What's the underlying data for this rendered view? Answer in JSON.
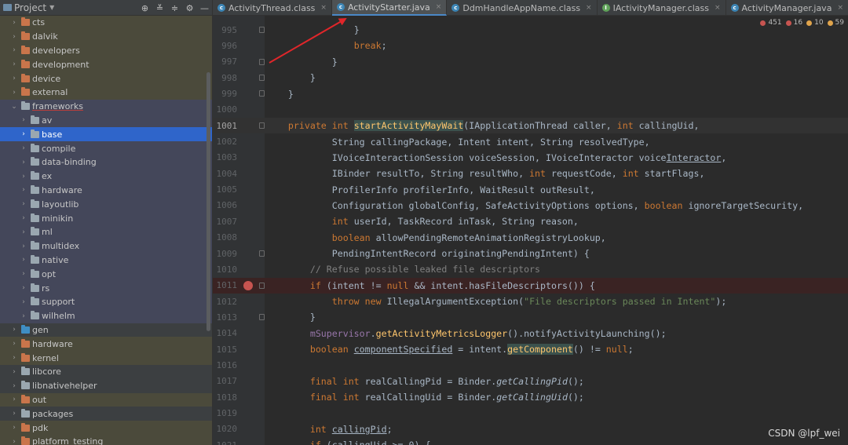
{
  "panel": {
    "title": "Project",
    "header_icons": [
      "⊕",
      "≚",
      "≑",
      "⚙",
      "—"
    ]
  },
  "tree": [
    {
      "label": "cts",
      "depth": 0,
      "chev": "›",
      "color": "orange",
      "tint": "tint"
    },
    {
      "label": "dalvik",
      "depth": 0,
      "chev": "›",
      "color": "orange",
      "tint": "tint"
    },
    {
      "label": "developers",
      "depth": 0,
      "chev": "›",
      "color": "orange",
      "tint": "tint"
    },
    {
      "label": "development",
      "depth": 0,
      "chev": "›",
      "color": "orange",
      "tint": "tint"
    },
    {
      "label": "device",
      "depth": 0,
      "chev": "›",
      "color": "orange",
      "tint": "tint"
    },
    {
      "label": "external",
      "depth": 0,
      "chev": "›",
      "color": "orange",
      "tint": "tint"
    },
    {
      "label": "frameworks",
      "depth": 0,
      "chev": "⌄",
      "color": "grey",
      "tint": "tint-blue",
      "underline": true
    },
    {
      "label": "av",
      "depth": 1,
      "chev": "›",
      "color": "grey",
      "tint": "tint-blue"
    },
    {
      "label": "base",
      "depth": 1,
      "chev": "›",
      "color": "grey",
      "tint": "selected"
    },
    {
      "label": "compile",
      "depth": 1,
      "chev": "›",
      "color": "grey",
      "tint": "tint-blue"
    },
    {
      "label": "data-binding",
      "depth": 1,
      "chev": "›",
      "color": "grey",
      "tint": "tint-blue"
    },
    {
      "label": "ex",
      "depth": 1,
      "chev": "›",
      "color": "grey",
      "tint": "tint-blue"
    },
    {
      "label": "hardware",
      "depth": 1,
      "chev": "›",
      "color": "grey",
      "tint": "tint-blue"
    },
    {
      "label": "layoutlib",
      "depth": 1,
      "chev": "›",
      "color": "grey",
      "tint": "tint-blue"
    },
    {
      "label": "minikin",
      "depth": 1,
      "chev": "›",
      "color": "grey",
      "tint": "tint-blue"
    },
    {
      "label": "ml",
      "depth": 1,
      "chev": "›",
      "color": "grey",
      "tint": "tint-blue"
    },
    {
      "label": "multidex",
      "depth": 1,
      "chev": "›",
      "color": "grey",
      "tint": "tint-blue"
    },
    {
      "label": "native",
      "depth": 1,
      "chev": "›",
      "color": "grey",
      "tint": "tint-blue"
    },
    {
      "label": "opt",
      "depth": 1,
      "chev": "›",
      "color": "grey",
      "tint": "tint-blue"
    },
    {
      "label": "rs",
      "depth": 1,
      "chev": "›",
      "color": "grey",
      "tint": "tint-blue"
    },
    {
      "label": "support",
      "depth": 1,
      "chev": "›",
      "color": "grey",
      "tint": "tint-blue"
    },
    {
      "label": "wilhelm",
      "depth": 1,
      "chev": "›",
      "color": "grey",
      "tint": "tint-blue"
    },
    {
      "label": "gen",
      "depth": 0,
      "chev": "›",
      "color": "blue",
      "tint": ""
    },
    {
      "label": "hardware",
      "depth": 0,
      "chev": "›",
      "color": "orange",
      "tint": "tint"
    },
    {
      "label": "kernel",
      "depth": 0,
      "chev": "›",
      "color": "orange",
      "tint": "tint"
    },
    {
      "label": "libcore",
      "depth": 0,
      "chev": "›",
      "color": "grey",
      "tint": ""
    },
    {
      "label": "libnativehelper",
      "depth": 0,
      "chev": "›",
      "color": "grey",
      "tint": ""
    },
    {
      "label": "out",
      "depth": 0,
      "chev": "›",
      "color": "orange",
      "tint": "tint"
    },
    {
      "label": "packages",
      "depth": 0,
      "chev": "›",
      "color": "grey",
      "tint": ""
    },
    {
      "label": "pdk",
      "depth": 0,
      "chev": "›",
      "color": "orange",
      "tint": "tint"
    },
    {
      "label": "platform_testing",
      "depth": 0,
      "chev": "›",
      "color": "orange",
      "tint": "tint"
    }
  ],
  "tabs": [
    {
      "label": "ActivityThread.class",
      "icon": "c",
      "kind": "class",
      "active": false
    },
    {
      "label": "ActivityStarter.java",
      "icon": "c",
      "kind": "class",
      "active": true
    },
    {
      "label": "DdmHandleAppName.class",
      "icon": "c",
      "kind": "class",
      "active": false
    },
    {
      "label": "IActivityManager.class",
      "icon": "I",
      "kind": "iface",
      "active": false
    },
    {
      "label": "ActivityManager.java",
      "icon": "c",
      "kind": "class",
      "active": false
    }
  ],
  "tab_close": "×",
  "indicators": [
    {
      "count": "451",
      "color": "#c75450"
    },
    {
      "count": "16",
      "color": "#c75450"
    },
    {
      "count": "10",
      "color": "#e0a44c"
    },
    {
      "count": "59",
      "color": "#e0a44c"
    }
  ],
  "code_lines": [
    {
      "n": "995",
      "fold": true,
      "tokens": [
        [
          "",
          "                "
        ],
        [
          "",
          "}"
        ]
      ]
    },
    {
      "n": "996",
      "tokens": [
        [
          "",
          "                "
        ],
        [
          "kw",
          "break"
        ],
        [
          "",
          ";"
        ]
      ]
    },
    {
      "n": "997",
      "fold": true,
      "tokens": [
        [
          "",
          "            "
        ],
        [
          "",
          "}"
        ]
      ]
    },
    {
      "n": "998",
      "fold": true,
      "tokens": [
        [
          "",
          "        "
        ],
        [
          "",
          "}"
        ]
      ]
    },
    {
      "n": "999",
      "fold": true,
      "tokens": [
        [
          "",
          "    "
        ],
        [
          "",
          "}"
        ]
      ]
    },
    {
      "n": "1000",
      "tokens": []
    },
    {
      "n": "1001",
      "cur": true,
      "fold": true,
      "tokens": [
        [
          "",
          "    "
        ],
        [
          "kw",
          "private int "
        ],
        [
          "fnhl",
          "startActivityMayWait"
        ],
        [
          "",
          "(IApplicationThread caller, "
        ],
        [
          "kw",
          "int "
        ],
        [
          "",
          "callingUid,"
        ]
      ]
    },
    {
      "n": "1002",
      "tokens": [
        [
          "",
          "            String callingPackage, Intent intent, String resolvedType,"
        ]
      ]
    },
    {
      "n": "1003",
      "tokens": [
        [
          "",
          "            IVoiceInteractionSession voiceSession, IVoiceInteractor voice"
        ],
        [
          "und",
          "Interactor"
        ],
        [
          "",
          ","
        ]
      ]
    },
    {
      "n": "1004",
      "tokens": [
        [
          "",
          "            IBinder resultTo, String resultWho, "
        ],
        [
          "kw",
          "int "
        ],
        [
          "",
          "requestCode, "
        ],
        [
          "kw",
          "int "
        ],
        [
          "",
          "startFlags,"
        ]
      ]
    },
    {
      "n": "1005",
      "tokens": [
        [
          "",
          "            ProfilerInfo profilerInfo, WaitResult outResult,"
        ]
      ]
    },
    {
      "n": "1006",
      "tokens": [
        [
          "",
          "            Configuration globalConfig, SafeActivityOptions options, "
        ],
        [
          "kw",
          "boolean "
        ],
        [
          "",
          "ignoreTargetSecurity,"
        ]
      ]
    },
    {
      "n": "1007",
      "tokens": [
        [
          "",
          "            "
        ],
        [
          "kw",
          "int "
        ],
        [
          "",
          "userId, TaskRecord inTask, String reason,"
        ]
      ]
    },
    {
      "n": "1008",
      "tokens": [
        [
          "",
          "            "
        ],
        [
          "kw",
          "boolean "
        ],
        [
          "",
          "allowPendingRemoteAnimationRegistryLookup,"
        ]
      ]
    },
    {
      "n": "1009",
      "fold": true,
      "tokens": [
        [
          "",
          "            PendingIntentRecord originatingPendingIntent) {"
        ]
      ]
    },
    {
      "n": "1010",
      "tokens": [
        [
          "",
          "        "
        ],
        [
          "cmt",
          "// Refuse possible leaked file descriptors"
        ]
      ]
    },
    {
      "n": "1011",
      "bp": true,
      "fold": true,
      "tokens": [
        [
          "",
          "        "
        ],
        [
          "kw",
          "if "
        ],
        [
          "",
          "(intent != "
        ],
        [
          "kw",
          "null "
        ],
        [
          "",
          "&& intent.hasFileDescriptors()) {"
        ]
      ]
    },
    {
      "n": "1012",
      "tokens": [
        [
          "",
          "            "
        ],
        [
          "kw",
          "throw new "
        ],
        [
          "",
          "IllegalArgumentException("
        ],
        [
          "str",
          "\"File descriptors passed in Intent\""
        ],
        [
          "",
          ");"
        ]
      ]
    },
    {
      "n": "1013",
      "fold": true,
      "tokens": [
        [
          "",
          "        }"
        ]
      ]
    },
    {
      "n": "1014",
      "tokens": [
        [
          "",
          "        "
        ],
        [
          "fld",
          "mSupervisor"
        ],
        [
          "",
          "."
        ],
        [
          "fn",
          "getActivityMetricsLogger"
        ],
        [
          "",
          "().notifyActivityLaunching();"
        ]
      ]
    },
    {
      "n": "1015",
      "tokens": [
        [
          "",
          "        "
        ],
        [
          "kw",
          "boolean "
        ],
        [
          "und",
          "componentSpecified"
        ],
        [
          "",
          " = intent."
        ],
        [
          "fnhl",
          "getComponent"
        ],
        [
          "",
          "() != "
        ],
        [
          "kw",
          "null"
        ],
        [
          "",
          ";"
        ]
      ]
    },
    {
      "n": "1016",
      "tokens": []
    },
    {
      "n": "1017",
      "tokens": [
        [
          "",
          "        "
        ],
        [
          "kw",
          "final int "
        ],
        [
          "",
          "realCallingPid = Binder."
        ],
        [
          "ital",
          "getCallingPid"
        ],
        [
          "",
          "();"
        ]
      ]
    },
    {
      "n": "1018",
      "tokens": [
        [
          "",
          "        "
        ],
        [
          "kw",
          "final int "
        ],
        [
          "",
          "realCallingUid = Binder."
        ],
        [
          "ital",
          "getCallingUid"
        ],
        [
          "",
          "();"
        ]
      ]
    },
    {
      "n": "1019",
      "tokens": []
    },
    {
      "n": "1020",
      "tokens": [
        [
          "",
          "        "
        ],
        [
          "kw",
          "int "
        ],
        [
          "und",
          "callingPid"
        ],
        [
          "",
          ";"
        ]
      ]
    },
    {
      "n": "1021",
      "tokens": [
        [
          "",
          "        "
        ],
        [
          "kw",
          "if "
        ],
        [
          "",
          "(callingUid >= "
        ],
        [
          "",
          "0"
        ],
        [
          "",
          ") {"
        ]
      ]
    }
  ],
  "watermark": "CSDN @lpf_wei",
  "colors": {
    "annotation_arrow": "#e0262a",
    "selection": "#2f65ca",
    "keyword": "#cc7832",
    "method": "#ffc66d"
  }
}
